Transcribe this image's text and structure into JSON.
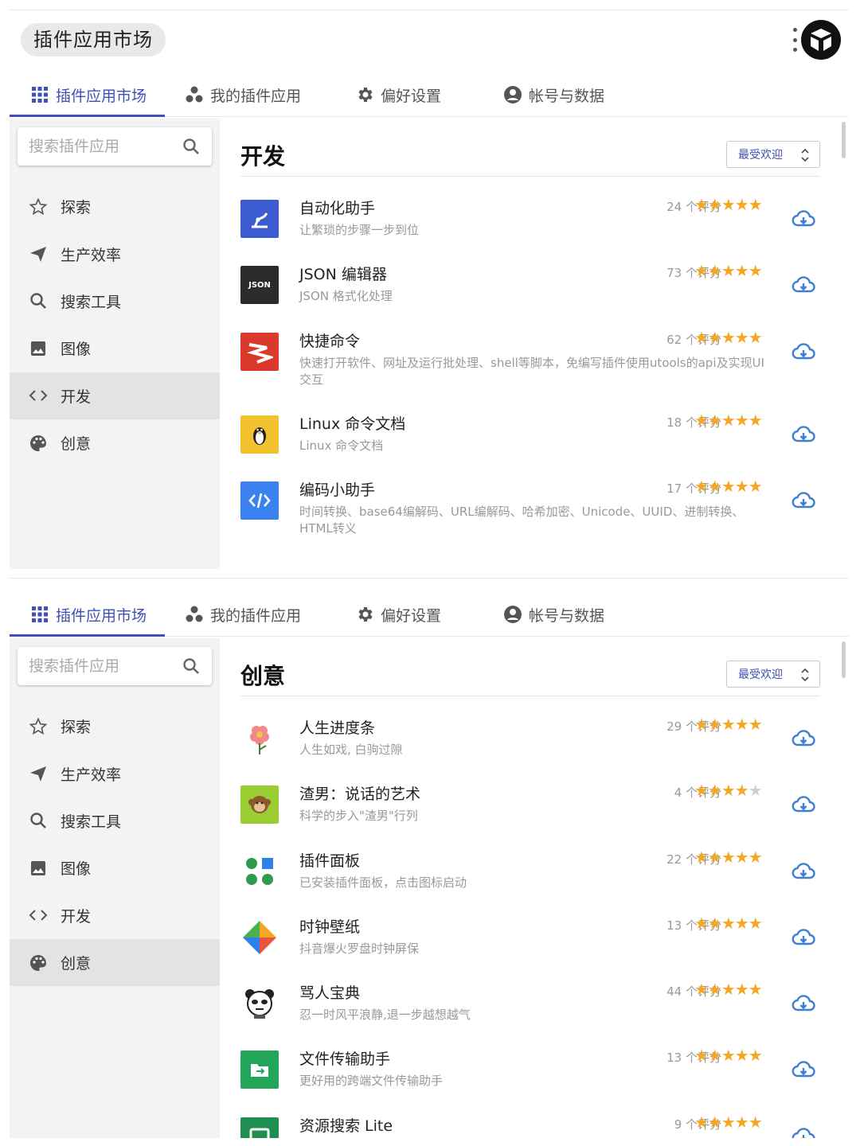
{
  "app": {
    "title": "插件应用市场"
  },
  "tabs": [
    {
      "label": "插件应用市场",
      "icon": "grid-icon"
    },
    {
      "label": "我的插件应用",
      "icon": "dots-icon"
    },
    {
      "label": "偏好设置",
      "icon": "gear-icon"
    },
    {
      "label": "帐号与数据",
      "icon": "account-icon"
    }
  ],
  "search": {
    "placeholder": "搜索插件应用"
  },
  "sidebar": {
    "items": [
      {
        "label": "探索",
        "icon": "star-outline-icon"
      },
      {
        "label": "生产效率",
        "icon": "send-icon"
      },
      {
        "label": "搜索工具",
        "icon": "search-icon"
      },
      {
        "label": "图像",
        "icon": "image-icon"
      },
      {
        "label": "开发",
        "icon": "code-icon"
      },
      {
        "label": "创意",
        "icon": "palette-icon"
      }
    ]
  },
  "sort": {
    "label": "最受欢迎"
  },
  "colors": {
    "accent": "#3f51b5",
    "star": "#f5a623",
    "download": "#3f7fd0"
  },
  "panels": [
    {
      "section": "开发",
      "active_nav": 4,
      "items": [
        {
          "name": "自动化助手",
          "desc": "让繁琐的步骤一步到位",
          "count": "24 个评分",
          "stars": 5,
          "icon": "robot-arm-icon",
          "icon_bg": "#3c5bd0"
        },
        {
          "name": "JSON 编辑器",
          "desc": "JSON 格式化处理",
          "count": "73 个评分",
          "stars": 5,
          "icon": "json-icon",
          "icon_bg": "#2c2c2c",
          "icon_text": "JSON"
        },
        {
          "name": "快捷命令",
          "desc": "快速打开软件、网址及运行批处理、shell等脚本，免编写插件使用utools的api及实现UI交互",
          "count": "62 个评分",
          "stars": 5,
          "icon": "zigzag-icon",
          "icon_bg": "#d93a2b"
        },
        {
          "name": "Linux 命令文档",
          "desc": "Linux 命令文档",
          "count": "18 个评分",
          "stars": 5,
          "icon": "penguin-icon",
          "icon_bg": "#f2c12e"
        },
        {
          "name": "编码小助手",
          "desc": "时间转换、base64编解码、URL编解码、哈希加密、Unicode、UUID、进制转换、HTML转义",
          "count": "17 个评分",
          "stars": 5,
          "icon": "code-brackets-icon",
          "icon_bg": "#3b82f0"
        }
      ]
    },
    {
      "section": "创意",
      "active_nav": 5,
      "items": [
        {
          "name": "人生进度条",
          "desc": "人生如戏, 白驹过隙",
          "count": "29 个评分",
          "stars": 5,
          "icon": "flower-icon",
          "icon_bg": "#ffffff"
        },
        {
          "name": "渣男：说话的艺术",
          "desc": "科学的步入\"渣男\"行列",
          "count": "4 个评分",
          "stars": 4,
          "icon": "monkey-icon",
          "icon_bg": "#9acd32"
        },
        {
          "name": "插件面板",
          "desc": "已安装插件面板，点击图标启动",
          "count": "22 个评分",
          "stars": 5,
          "icon": "panel-dots-icon",
          "icon_bg": "#ffffff"
        },
        {
          "name": "时钟壁纸",
          "desc": "抖音爆火罗盘时钟屏保",
          "count": "13 个评分",
          "stars": 5,
          "icon": "pinwheel-icon",
          "icon_bg": "#ffffff"
        },
        {
          "name": "骂人宝典",
          "desc": "忍一时风平浪静,退一步越想越气",
          "count": "44 个评分",
          "stars": 5,
          "icon": "panda-icon",
          "icon_bg": "#ffffff"
        },
        {
          "name": "文件传输助手",
          "desc": "更好用的跨端文件传输助手",
          "count": "13 个评分",
          "stars": 5,
          "icon": "folder-transfer-icon",
          "icon_bg": "#22a65a"
        },
        {
          "name": "资源搜索 Lite",
          "desc": "",
          "count": "9 个评分",
          "stars": 5,
          "icon": "monitor-icon",
          "icon_bg": "#1e8f4e"
        }
      ]
    }
  ]
}
